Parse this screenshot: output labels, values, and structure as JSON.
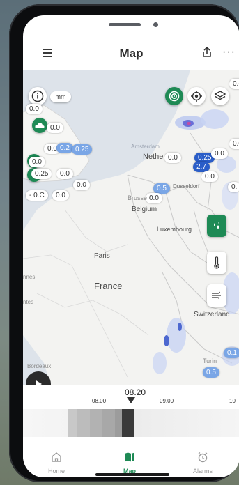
{
  "header": {
    "title": "Map"
  },
  "map": {
    "unit_label": "mm",
    "labels": {
      "amsterdam": "Amsterdam",
      "netherlands": "Nethe",
      "dusseldorf": "Dusseldorf",
      "brussels": "Brusse",
      "belgium": "Belgium",
      "luxembourg": "Luxembourg",
      "paris": "Paris",
      "france": "France",
      "switzerland": "Switzerland",
      "turin": "Turin",
      "nnes": "nnes",
      "ntes": "ntes",
      "bordeaux": "Bordeaux"
    },
    "badges": {
      "b1": "0.0",
      "b2": "0.0",
      "b3": "0.0",
      "b4": "0.2",
      "b5": "0.25",
      "b6": "0.0",
      "b7": "0.25",
      "b8": "0.0",
      "b9": "0.0",
      "b10": "- 0.C",
      "b11": "0.0",
      "b12": "0.0",
      "b13": "0.25",
      "b14": "0.0",
      "b15": "2.7",
      "b16": "0.0",
      "b17": "0.5",
      "b18": "0.0",
      "b19": "0.",
      "b20": "0.5",
      "b21": "0.1",
      "b22": "0.C",
      "b23": "0.0"
    }
  },
  "timeline": {
    "current": "08.20",
    "ticks": [
      "08.00",
      "09.00",
      "10"
    ]
  },
  "nav": {
    "home": "Home",
    "map": "Map",
    "alarms": "Alarms"
  },
  "colors": {
    "accent": "#1e8a55",
    "rain_light": "#7aa6e6",
    "rain_dark": "#2a5dc8"
  }
}
